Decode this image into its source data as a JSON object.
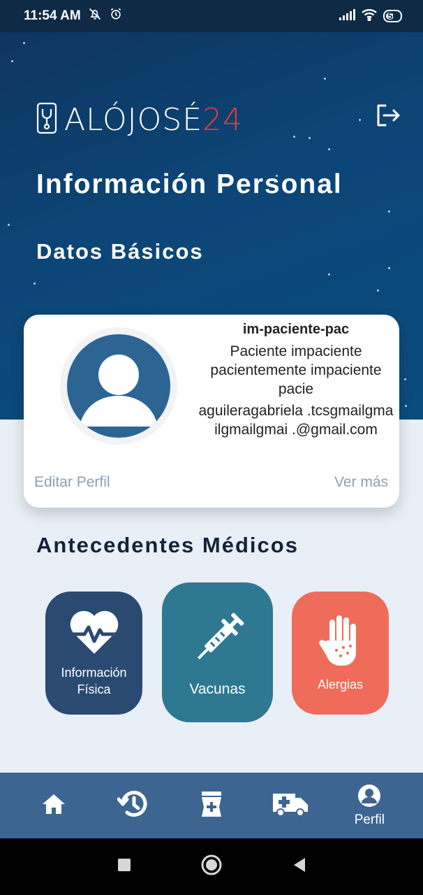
{
  "status_bar": {
    "time": "11:54 AM",
    "battery": "50",
    "battery_level": 0.5
  },
  "header": {
    "logo_main": "ALÓJOSÉ",
    "logo_number": "24",
    "logout_icon": "logout-icon"
  },
  "page_title": "Información Personal",
  "basic_section_title": "Datos Básicos",
  "profile": {
    "username": "im-paciente-pac",
    "full_name": "Paciente impaciente pacientemente impaciente pacie",
    "email": "aguileragabriela .tcsgmailgmailgmailgmai .@gmail.com",
    "edit_label": "Editar Perfil",
    "more_label": "Ver más"
  },
  "antecedentes": {
    "title": "Antecedentes Médicos",
    "tiles": [
      {
        "label": "Información Física",
        "icon": "heart-pulse-icon",
        "color": "#2a4a72"
      },
      {
        "label": "Vacunas",
        "icon": "syringe-icon",
        "color": "#2e7892"
      },
      {
        "label": "Alergias",
        "icon": "allergy-hand-icon",
        "color": "#f06c5a"
      }
    ]
  },
  "bottom_nav": {
    "items": [
      {
        "icon": "home-icon",
        "label": ""
      },
      {
        "icon": "history-icon",
        "label": ""
      },
      {
        "icon": "pharmacy-icon",
        "label": ""
      },
      {
        "icon": "ambulance-icon",
        "label": ""
      },
      {
        "icon": "profile-icon",
        "label": "Perfil"
      }
    ]
  },
  "colors": {
    "hero_bg": "#0c4677",
    "accent_red": "#e03b3b",
    "nav_bg": "#3d6591",
    "page_bg": "#e9eff7"
  }
}
